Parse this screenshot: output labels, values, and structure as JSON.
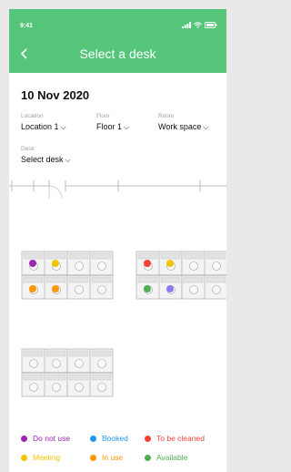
{
  "status": {
    "time": "9:41"
  },
  "header": {
    "title": "Select a desk"
  },
  "date": "10 Nov 2020",
  "filters": {
    "location": {
      "label": "Location",
      "value": "Location 1"
    },
    "floor": {
      "label": "Floor",
      "value": "Floor 1"
    },
    "room": {
      "label": "Room",
      "value": "Work space"
    },
    "desk": {
      "label": "Desk",
      "value": "Select desk"
    }
  },
  "legend": [
    {
      "label": "Do not use",
      "color": "#9c27b0"
    },
    {
      "label": "Booked",
      "color": "#2196f3"
    },
    {
      "label": "To be cleaned",
      "color": "#f44336"
    },
    {
      "label": "Meeting",
      "color": "#f5c400"
    },
    {
      "label": "In use",
      "color": "#ff9800"
    },
    {
      "label": "Available",
      "color": "#4caf50"
    }
  ],
  "desk_status_colors": {
    "purple": "#9c27b0",
    "yellow": "#f5c400",
    "red": "#f44336",
    "orange": "#ff9800",
    "green": "#4caf50",
    "violet": "#8a7cf0"
  }
}
